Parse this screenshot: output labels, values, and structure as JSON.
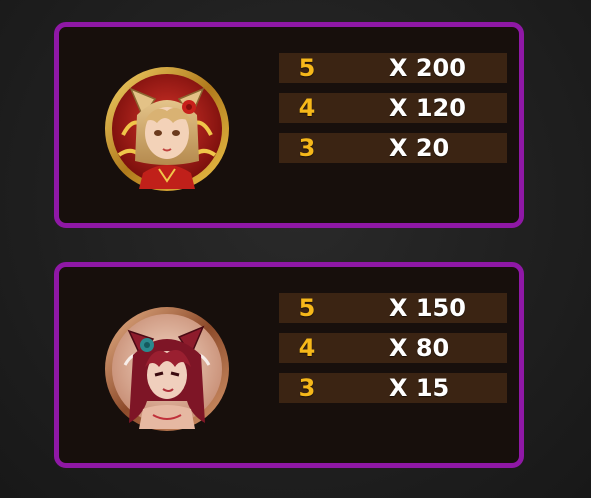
{
  "colors": {
    "background": "#1f1f1f",
    "card_border": "#8f18a6",
    "card_fill": "#170f0c",
    "row_fill": "#3b2413",
    "count_text": "#f6b81a",
    "multiplier_text": "#ffffff"
  },
  "cards": [
    {
      "symbol": "blonde-fox-girl-icon",
      "rows": [
        {
          "count": "5",
          "multiplier": "X 200"
        },
        {
          "count": "4",
          "multiplier": "X 120"
        },
        {
          "count": "3",
          "multiplier": "X 20"
        }
      ]
    },
    {
      "symbol": "redhead-fox-girl-icon",
      "rows": [
        {
          "count": "5",
          "multiplier": "X 150"
        },
        {
          "count": "4",
          "multiplier": "X 80"
        },
        {
          "count": "3",
          "multiplier": "X 15"
        }
      ]
    }
  ]
}
